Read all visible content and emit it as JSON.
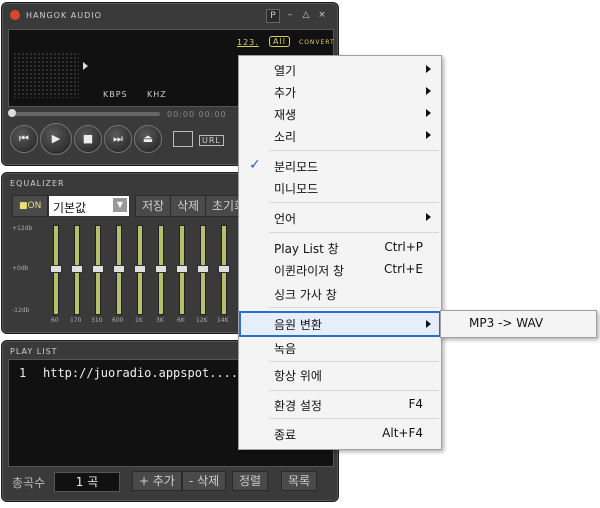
{
  "player": {
    "title": "HANGOK AUDIO",
    "titlebar_buttons": [
      "P",
      "–",
      "△",
      "×"
    ],
    "mode_buttons": [
      "123.",
      "All",
      "CONVERT"
    ],
    "kbps_label": "KBPS",
    "khz_label": "KHZ",
    "time": "00:00 00:00",
    "url_button": "URL"
  },
  "equalizer": {
    "title": "EQUALIZER",
    "on_button": "ON",
    "preset_value": "기본값",
    "save_button": "저장",
    "delete_button": "삭제",
    "reset_button": "초기화",
    "db_labels": [
      "+12db",
      "+0db",
      "-12db"
    ],
    "bands": [
      "60",
      "170",
      "310",
      "600",
      "1K",
      "3K",
      "6K",
      "12K",
      "14K"
    ]
  },
  "playlist": {
    "title": "PLAY LIST",
    "items": [
      {
        "index": "1",
        "text": "http://juoradio.appspot...."
      }
    ],
    "total_label": "총곡수",
    "total_value": "1 곡",
    "add_button": "+ 추가",
    "remove_button": "- 삭제",
    "sort_button": "정렬",
    "list_button": "목록"
  },
  "menu": {
    "open": "열기",
    "add": "추가",
    "play": "재생",
    "sound": "소리",
    "split_mode": "분리모드",
    "mini_mode": "미니모드",
    "language": "언어",
    "playlist_window": "Play List 창",
    "playlist_shortcut": "Ctrl+P",
    "eq_window": "이퀸라이저 창",
    "eq_shortcut": "Ctrl+E",
    "sync_lyrics": "싱크 가사 창",
    "convert": "음원 변환",
    "record": "녹음",
    "always_on_top": "항상 위에",
    "settings": "환경 설정",
    "settings_shortcut": "F4",
    "exit": "종료",
    "exit_shortcut": "Alt+F4",
    "check_mark": "✓"
  },
  "submenu": {
    "item": "MP3 -> WAV"
  }
}
